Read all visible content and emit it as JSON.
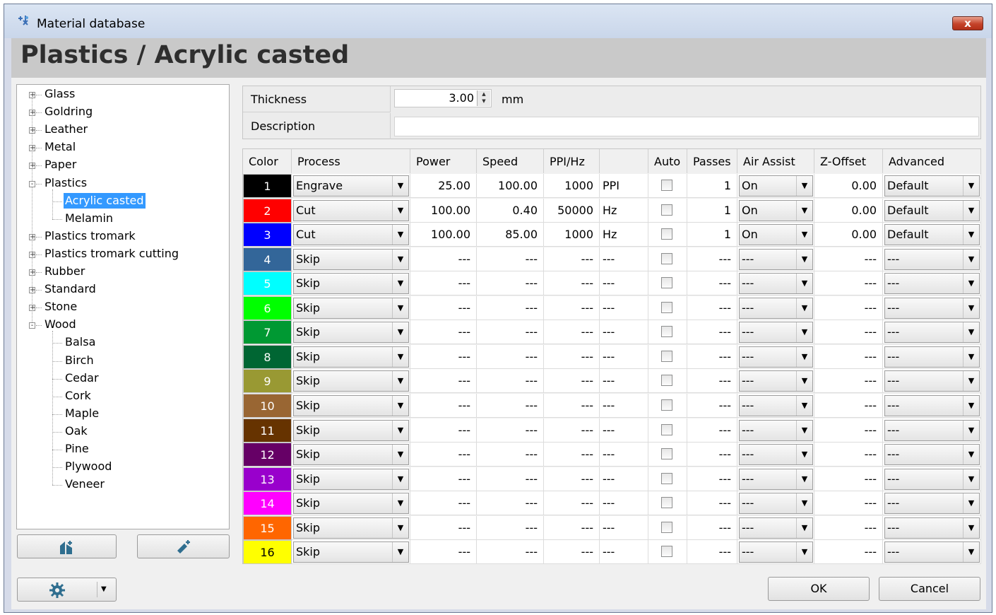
{
  "window": {
    "title": "Material database",
    "close_label": "x"
  },
  "page_title": "Plastics / Acrylic casted",
  "tree": [
    {
      "label": "Glass",
      "level": 0,
      "expander": "+"
    },
    {
      "label": "Goldring",
      "level": 0,
      "expander": "+"
    },
    {
      "label": "Leather",
      "level": 0,
      "expander": "+"
    },
    {
      "label": "Metal",
      "level": 0,
      "expander": "+"
    },
    {
      "label": "Paper",
      "level": 0,
      "expander": "+"
    },
    {
      "label": "Plastics",
      "level": 0,
      "expander": "-"
    },
    {
      "label": "Acrylic casted",
      "level": 1,
      "selected": true
    },
    {
      "label": "Melamin",
      "level": 1
    },
    {
      "label": "Plastics tromark",
      "level": 0,
      "expander": "+"
    },
    {
      "label": "Plastics tromark cutting",
      "level": 0,
      "expander": "+"
    },
    {
      "label": "Rubber",
      "level": 0,
      "expander": "+"
    },
    {
      "label": "Standard",
      "level": 0,
      "expander": "+"
    },
    {
      "label": "Stone",
      "level": 0,
      "expander": "+"
    },
    {
      "label": "Wood",
      "level": 0,
      "expander": "-"
    },
    {
      "label": "Balsa",
      "level": 1
    },
    {
      "label": "Birch",
      "level": 1
    },
    {
      "label": "Cedar",
      "level": 1
    },
    {
      "label": "Cork",
      "level": 1
    },
    {
      "label": "Maple",
      "level": 1
    },
    {
      "label": "Oak",
      "level": 1
    },
    {
      "label": "Pine",
      "level": 1
    },
    {
      "label": "Plywood",
      "level": 1
    },
    {
      "label": "Veneer",
      "level": 1
    }
  ],
  "properties": {
    "thickness_label": "Thickness",
    "thickness_value": "3.00",
    "thickness_unit": "mm",
    "description_label": "Description",
    "description_value": ""
  },
  "columns": [
    "Color",
    "Process",
    "Power",
    "Speed",
    "PPI/Hz",
    "",
    "Auto",
    "Passes",
    "Air Assist",
    "Z-Offset",
    "Advanced"
  ],
  "rows": [
    {
      "n": "1",
      "color": "#000000",
      "process": "Engrave",
      "power": "25.00",
      "speed": "100.00",
      "ppi": "1000",
      "unit": "PPI",
      "passes": "1",
      "air": "On",
      "z": "0.00",
      "adv": "Default"
    },
    {
      "n": "2",
      "color": "#ff0000",
      "process": "Cut",
      "power": "100.00",
      "speed": "0.40",
      "ppi": "50000",
      "unit": "Hz",
      "passes": "1",
      "air": "On",
      "z": "0.00",
      "adv": "Default"
    },
    {
      "n": "3",
      "color": "#0000ff",
      "process": "Cut",
      "power": "100.00",
      "speed": "85.00",
      "ppi": "1000",
      "unit": "Hz",
      "passes": "1",
      "air": "On",
      "z": "0.00",
      "adv": "Default"
    },
    {
      "n": "4",
      "color": "#336699",
      "process": "Skip",
      "power": "---",
      "speed": "---",
      "ppi": "---",
      "unit": "---",
      "passes": "---",
      "air": "---",
      "z": "---",
      "adv": "---"
    },
    {
      "n": "5",
      "color": "#00ffff",
      "process": "Skip",
      "power": "---",
      "speed": "---",
      "ppi": "---",
      "unit": "---",
      "passes": "---",
      "air": "---",
      "z": "---",
      "adv": "---"
    },
    {
      "n": "6",
      "color": "#00ff00",
      "process": "Skip",
      "power": "---",
      "speed": "---",
      "ppi": "---",
      "unit": "---",
      "passes": "---",
      "air": "---",
      "z": "---",
      "adv": "---"
    },
    {
      "n": "7",
      "color": "#009933",
      "process": "Skip",
      "power": "---",
      "speed": "---",
      "ppi": "---",
      "unit": "---",
      "passes": "---",
      "air": "---",
      "z": "---",
      "adv": "---"
    },
    {
      "n": "8",
      "color": "#006633",
      "process": "Skip",
      "power": "---",
      "speed": "---",
      "ppi": "---",
      "unit": "---",
      "passes": "---",
      "air": "---",
      "z": "---",
      "adv": "---"
    },
    {
      "n": "9",
      "color": "#999933",
      "process": "Skip",
      "power": "---",
      "speed": "---",
      "ppi": "---",
      "unit": "---",
      "passes": "---",
      "air": "---",
      "z": "---",
      "adv": "---"
    },
    {
      "n": "10",
      "color": "#996633",
      "process": "Skip",
      "power": "---",
      "speed": "---",
      "ppi": "---",
      "unit": "---",
      "passes": "---",
      "air": "---",
      "z": "---",
      "adv": "---"
    },
    {
      "n": "11",
      "color": "#663300",
      "process": "Skip",
      "power": "---",
      "speed": "---",
      "ppi": "---",
      "unit": "---",
      "passes": "---",
      "air": "---",
      "z": "---",
      "adv": "---"
    },
    {
      "n": "12",
      "color": "#660066",
      "process": "Skip",
      "power": "---",
      "speed": "---",
      "ppi": "---",
      "unit": "---",
      "passes": "---",
      "air": "---",
      "z": "---",
      "adv": "---"
    },
    {
      "n": "13",
      "color": "#9900cc",
      "process": "Skip",
      "power": "---",
      "speed": "---",
      "ppi": "---",
      "unit": "---",
      "passes": "---",
      "air": "---",
      "z": "---",
      "adv": "---"
    },
    {
      "n": "14",
      "color": "#ff00ff",
      "process": "Skip",
      "power": "---",
      "speed": "---",
      "ppi": "---",
      "unit": "---",
      "passes": "---",
      "air": "---",
      "z": "---",
      "adv": "---"
    },
    {
      "n": "15",
      "color": "#ff6600",
      "process": "Skip",
      "power": "---",
      "speed": "---",
      "ppi": "---",
      "unit": "---",
      "passes": "---",
      "air": "---",
      "z": "---",
      "adv": "---"
    },
    {
      "n": "16",
      "color": "#ffff00",
      "process": "Skip",
      "power": "---",
      "speed": "---",
      "ppi": "---",
      "unit": "---",
      "passes": "---",
      "air": "---",
      "z": "---",
      "adv": "---"
    }
  ],
  "buttons": {
    "ok": "OK",
    "cancel": "Cancel"
  },
  "icons": {
    "title": "laser-app-icon",
    "add_material": "add-material-icon",
    "add_entry": "add-entry-icon",
    "settings": "gear-icon",
    "dropdown": "chevron-down-icon"
  }
}
